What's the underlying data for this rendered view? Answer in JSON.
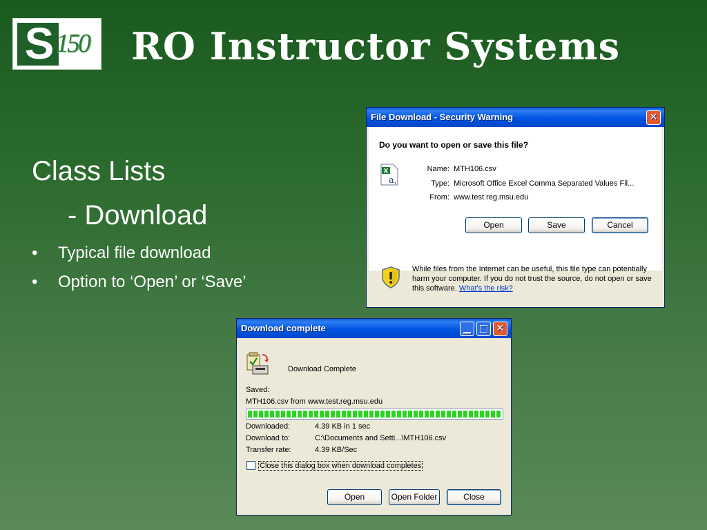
{
  "slide": {
    "title": "RO Instructor Systems",
    "logo": {
      "letter": "S",
      "number": "150"
    },
    "heading": "Class Lists",
    "subheading": "- Download",
    "bullets": [
      "Typical file download",
      "Option to ‘Open’ or ‘Save’"
    ],
    "bullet_glyph": "•"
  },
  "security_dialog": {
    "title": "File Download - Security Warning",
    "question": "Do you want to open or save this file?",
    "name_label": "Name:",
    "name_value": "MTH106.csv",
    "type_label": "Type:",
    "type_value": "Microsoft Office Excel Comma Separated Values Fil...",
    "from_label": "From:",
    "from_value": "www.test.reg.msu.edu",
    "open_button": "Open",
    "save_button": "Save",
    "cancel_button": "Cancel",
    "warning_text": "While files from the Internet can be useful, this file type can potentially harm your computer. If you do not trust the source, do not open or save this software.",
    "risk_link": "What's the risk?",
    "close_glyph": "✕",
    "file_icon": "excel-csv-icon",
    "warning_icon": "security-shield-icon"
  },
  "download_dialog": {
    "title": "Download complete",
    "heading": "Download Complete",
    "saved_label": "Saved:",
    "saved_value": "MTH106.csv from www.test.reg.msu.edu",
    "progress_percent": 100,
    "downloaded_label": "Downloaded:",
    "downloaded_value": "4.39 KB in 1 sec",
    "download_to_label": "Download to:",
    "download_to_value": "C:\\Documents and Setti...\\MTH106.csv",
    "transfer_label": "Transfer rate:",
    "transfer_value": "4.39 KB/Sec",
    "checkbox_label": "Close this dialog box when download completes",
    "checkbox_checked": false,
    "open_button": "Open",
    "open_folder_button": "Open Folder",
    "close_button": "Close",
    "minimize_glyph": "▁",
    "maximize_glyph": "□",
    "close_glyph": "✕",
    "download_icon": "download-complete-icon"
  },
  "colors": {
    "background_top": "#1a5a1f",
    "background_bottom": "#5a8a58",
    "xp_titlebar": "#0054e3",
    "xp_dialog": "#ece9d8",
    "close_button": "#e25a31",
    "progress_green": "#2bd41f",
    "logo_green": "#1f5f2a"
  }
}
